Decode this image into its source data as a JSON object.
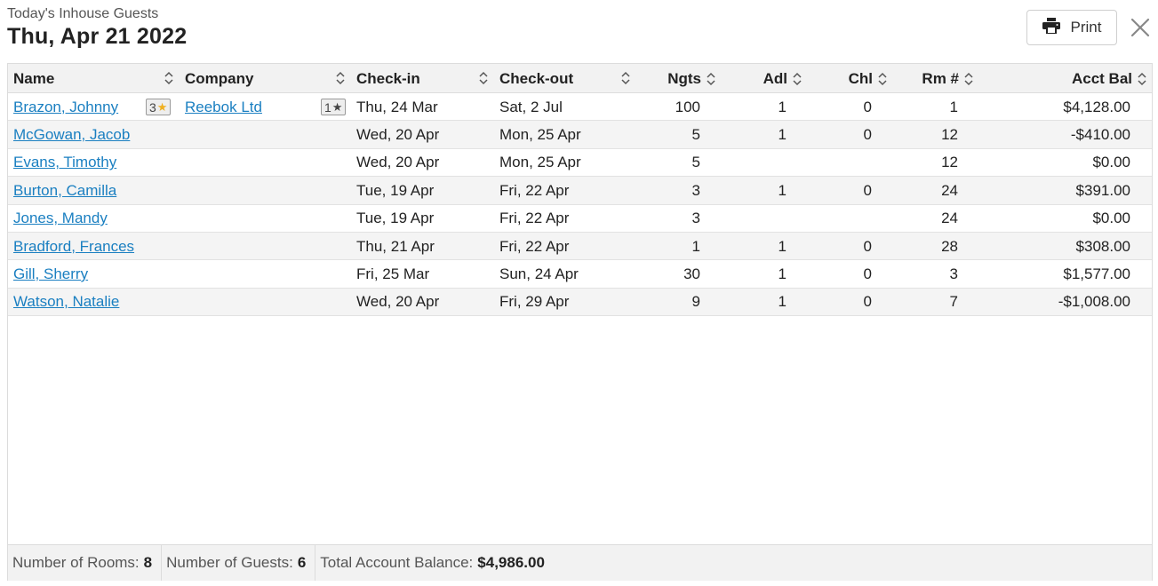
{
  "header": {
    "subtitle": "Today's Inhouse Guests",
    "title": "Thu, Apr 21 2022",
    "print_label": "Print"
  },
  "icons": {
    "print": "printer-icon",
    "close": "close-icon",
    "sort": "sort-icon",
    "star": "star-icon"
  },
  "colors": {
    "link": "#1a7fc1",
    "star_gold": "#f0b020",
    "header_bg": "#f2f2f2",
    "row_alt_bg": "#f4f4f4"
  },
  "columns": {
    "name": "Name",
    "company": "Company",
    "checkin": "Check-in",
    "checkout": "Check-out",
    "nights": "Ngts",
    "adults": "Adl",
    "children": "Chl",
    "room": "Rm #",
    "balance": "Acct Bal"
  },
  "rows": [
    {
      "name": "Brazon, Johnny",
      "guest_badge": "3",
      "company": "Reebok Ltd",
      "company_badge": "1",
      "checkin": "Thu, 24 Mar",
      "checkout": "Sat, 2 Jul",
      "nights": "100",
      "adults": "1",
      "children": "0",
      "room": "1",
      "balance": "$4,128.00"
    },
    {
      "name": "McGowan, Jacob",
      "guest_badge": "",
      "company": "",
      "company_badge": "",
      "checkin": "Wed, 20 Apr",
      "checkout": "Mon, 25 Apr",
      "nights": "5",
      "adults": "1",
      "children": "0",
      "room": "12",
      "balance": "-$410.00"
    },
    {
      "name": "Evans, Timothy",
      "guest_badge": "",
      "company": "",
      "company_badge": "",
      "checkin": "Wed, 20 Apr",
      "checkout": "Mon, 25 Apr",
      "nights": "5",
      "adults": "",
      "children": "",
      "room": "12",
      "balance": "$0.00"
    },
    {
      "name": "Burton, Camilla",
      "guest_badge": "",
      "company": "",
      "company_badge": "",
      "checkin": "Tue, 19 Apr",
      "checkout": "Fri, 22 Apr",
      "nights": "3",
      "adults": "1",
      "children": "0",
      "room": "24",
      "balance": "$391.00"
    },
    {
      "name": "Jones, Mandy",
      "guest_badge": "",
      "company": "",
      "company_badge": "",
      "checkin": "Tue, 19 Apr",
      "checkout": "Fri, 22 Apr",
      "nights": "3",
      "adults": "",
      "children": "",
      "room": "24",
      "balance": "$0.00"
    },
    {
      "name": "Bradford, Frances",
      "guest_badge": "",
      "company": "",
      "company_badge": "",
      "checkin": "Thu, 21 Apr",
      "checkout": "Fri, 22 Apr",
      "nights": "1",
      "adults": "1",
      "children": "0",
      "room": "28",
      "balance": "$308.00"
    },
    {
      "name": "Gill, Sherry",
      "guest_badge": "",
      "company": "",
      "company_badge": "",
      "checkin": "Fri, 25 Mar",
      "checkout": "Sun, 24 Apr",
      "nights": "30",
      "adults": "1",
      "children": "0",
      "room": "3",
      "balance": "$1,577.00"
    },
    {
      "name": "Watson, Natalie",
      "guest_badge": "",
      "company": "",
      "company_badge": "",
      "checkin": "Wed, 20 Apr",
      "checkout": "Fri, 29 Apr",
      "nights": "9",
      "adults": "1",
      "children": "0",
      "room": "7",
      "balance": "-$1,008.00"
    }
  ],
  "footer": {
    "rooms_label": "Number of Rooms:",
    "rooms_value": "8",
    "guests_label": "Number of Guests:",
    "guests_value": "6",
    "balance_label": "Total Account Balance:",
    "balance_value": "$4,986.00"
  }
}
